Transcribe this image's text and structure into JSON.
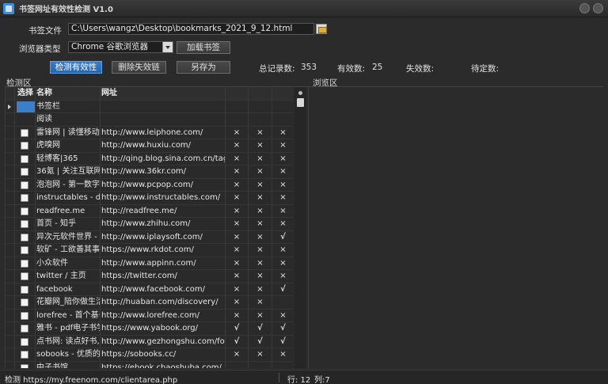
{
  "window": {
    "title": "书签网址有效性检测 V1.0"
  },
  "form": {
    "file_label": "书签文件",
    "file_path": "C:\\Users\\wangz\\Desktop\\bookmarks_2021_9_12.html",
    "browser_label": "浏览器类型",
    "browser_value": "Chrome 谷歌浏览器",
    "load_button": "加载书签",
    "check_button": "检测有效性",
    "remove_button": "删除失效链",
    "saveas_button": "另存为"
  },
  "stats": {
    "total_label": "总记录数:",
    "total_value": "353",
    "valid_label": "有效数:",
    "valid_value": "25",
    "invalid_label": "失效数:",
    "pending_label": "待定数:"
  },
  "sections": {
    "detect": "检测区",
    "preview": "浏览区"
  },
  "grid": {
    "headers": {
      "select": "选择",
      "name": "名称",
      "url": "网址"
    },
    "folders": [
      "书签栏",
      "阅读"
    ],
    "rows": [
      {
        "name": "雷锋网 | 读懂移动互",
        "url": "http://www.leiphone.com/",
        "m": [
          "x",
          "x",
          "x"
        ]
      },
      {
        "name": "虎嗅网",
        "url": "http://www.huxiu.com/",
        "m": [
          "x",
          "x",
          "x"
        ]
      },
      {
        "name": "轻博客|365",
        "url": "http://qing.blog.sina.com.cn/tag/365",
        "m": [
          "x",
          "x",
          "x"
        ]
      },
      {
        "name": "36氪 | 关注互联网创",
        "url": "http://www.36kr.com/",
        "m": [
          "x",
          "x",
          "x"
        ]
      },
      {
        "name": "泡泡网 - 第一数字产",
        "url": "http://www.pcpop.com/",
        "m": [
          "x",
          "x",
          "x"
        ]
      },
      {
        "name": "instructables - diy",
        "url": "http://www.instructables.com/",
        "m": [
          "x",
          "x",
          "x"
        ]
      },
      {
        "name": "readfree.me",
        "url": "http://readfree.me/",
        "m": [
          "x",
          "x",
          "x"
        ]
      },
      {
        "name": "首页 - 知乎",
        "url": "http://www.zhihu.com/",
        "m": [
          "x",
          "x",
          "x"
        ]
      },
      {
        "name": "异次元软件世界 - 软",
        "url": "http://www.iplaysoft.com/",
        "m": [
          "x",
          "x",
          "ok"
        ]
      },
      {
        "name": "软矿 - 工欲善其事,必",
        "url": "https://www.rkdot.com/",
        "m": [
          "x",
          "x",
          "x"
        ]
      },
      {
        "name": "小众软件",
        "url": "http://www.appinn.com/",
        "m": [
          "x",
          "x",
          "x"
        ]
      },
      {
        "name": "twitter / 主页",
        "url": "https://twitter.com/",
        "m": [
          "x",
          "x",
          "x"
        ]
      },
      {
        "name": "facebook",
        "url": "http://www.facebook.com/",
        "m": [
          "x",
          "x",
          "ok"
        ]
      },
      {
        "name": "花瓣网_陪你做生活",
        "url": "http://huaban.com/discovery/",
        "m": [
          "x",
          "x",
          ""
        ]
      },
      {
        "name": "lorefree - 首个基于",
        "url": "http://www.lorefree.com/",
        "m": [
          "x",
          "x",
          "x"
        ]
      },
      {
        "name": "雅书 - pdf电子书学习",
        "url": "https://www.yabook.org/",
        "m": [
          "ok",
          "ok",
          "ok"
        ]
      },
      {
        "name": "点书网: 读点好书,",
        "url": "http://www.gezhongshu.com/forum.ph",
        "m": [
          "ok",
          "ok",
          "ok"
        ]
      },
      {
        "name": "sobooks - 优质的",
        "url": "https://sobooks.cc/",
        "m": [
          "x",
          "x",
          "x"
        ]
      },
      {
        "name": "中子书馆",
        "url": "https://ebook.chaoshuba.com/",
        "m": [
          "",
          "",
          ""
        ]
      }
    ],
    "mark_x": "×",
    "mark_ok": "√"
  },
  "status": {
    "text": "检测 https://my.freenom.com/clientarea.php",
    "row": "行: 12",
    "col": "列:7"
  },
  "colors": {
    "accent": "#2f74c0",
    "error": "#e23a3a",
    "ok": "#3bd13b"
  }
}
